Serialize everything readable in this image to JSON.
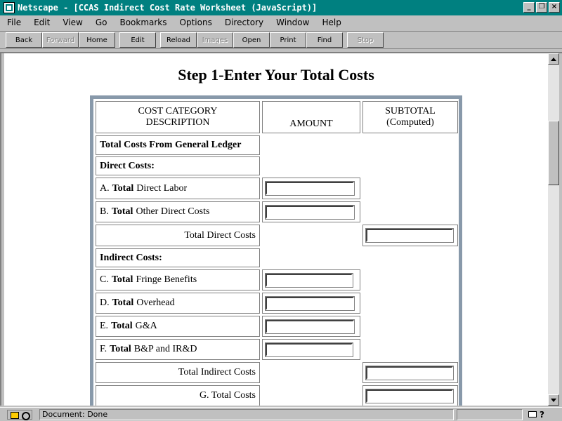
{
  "window": {
    "title": "Netscape - [CCAS Indirect Cost Rate Worksheet (JavaScript)]",
    "buttons": {
      "minimize": "_",
      "restore": "❐",
      "close": "×"
    }
  },
  "menu": [
    "File",
    "Edit",
    "View",
    "Go",
    "Bookmarks",
    "Options",
    "Directory",
    "Window",
    "Help"
  ],
  "toolbar": {
    "back": "Back",
    "forward": "Forward",
    "home": "Home",
    "edit": "Edit",
    "reload": "Reload",
    "images": "Images",
    "open": "Open",
    "print": "Print",
    "find": "Find",
    "stop": "Stop"
  },
  "page": {
    "heading": "Step 1-Enter Your Total Costs",
    "headers": {
      "category_line1": "COST CATEGORY",
      "category_line2": "DESCRIPTION",
      "amount": "AMOUNT",
      "subtotal_line1": "SUBTOTAL",
      "subtotal_line2": "(Computed)"
    },
    "rows": {
      "general_ledger": "Total Costs From General Ledger",
      "direct_costs": "Direct Costs:",
      "a_prefix": "A.",
      "a_bold": "Total",
      "a_rest": "Direct Labor",
      "b_prefix": "B.",
      "b_bold": "Total",
      "b_rest": "Other Direct Costs",
      "total_direct": "Total Direct Costs",
      "indirect_costs": "Indirect Costs:",
      "c_prefix": "C.",
      "c_bold": "Total",
      "c_rest": "Fringe Benefits",
      "d_prefix": "D.",
      "d_bold": "Total",
      "d_rest": "Overhead",
      "e_prefix": "E.",
      "e_bold": "Total",
      "e_rest": "G&A",
      "f_prefix": "F.",
      "f_bold": "Total",
      "f_rest": "B&P and IR&D",
      "total_indirect": "Total Indirect Costs",
      "g_total": "G. Total Costs"
    },
    "inputs": {
      "direct_labor": "",
      "other_direct": "",
      "total_direct": "",
      "fringe": "",
      "overhead": "",
      "ga": "",
      "bp_ird": "",
      "total_indirect": "",
      "total_costs": ""
    }
  },
  "status": {
    "text": "Document: Done"
  }
}
